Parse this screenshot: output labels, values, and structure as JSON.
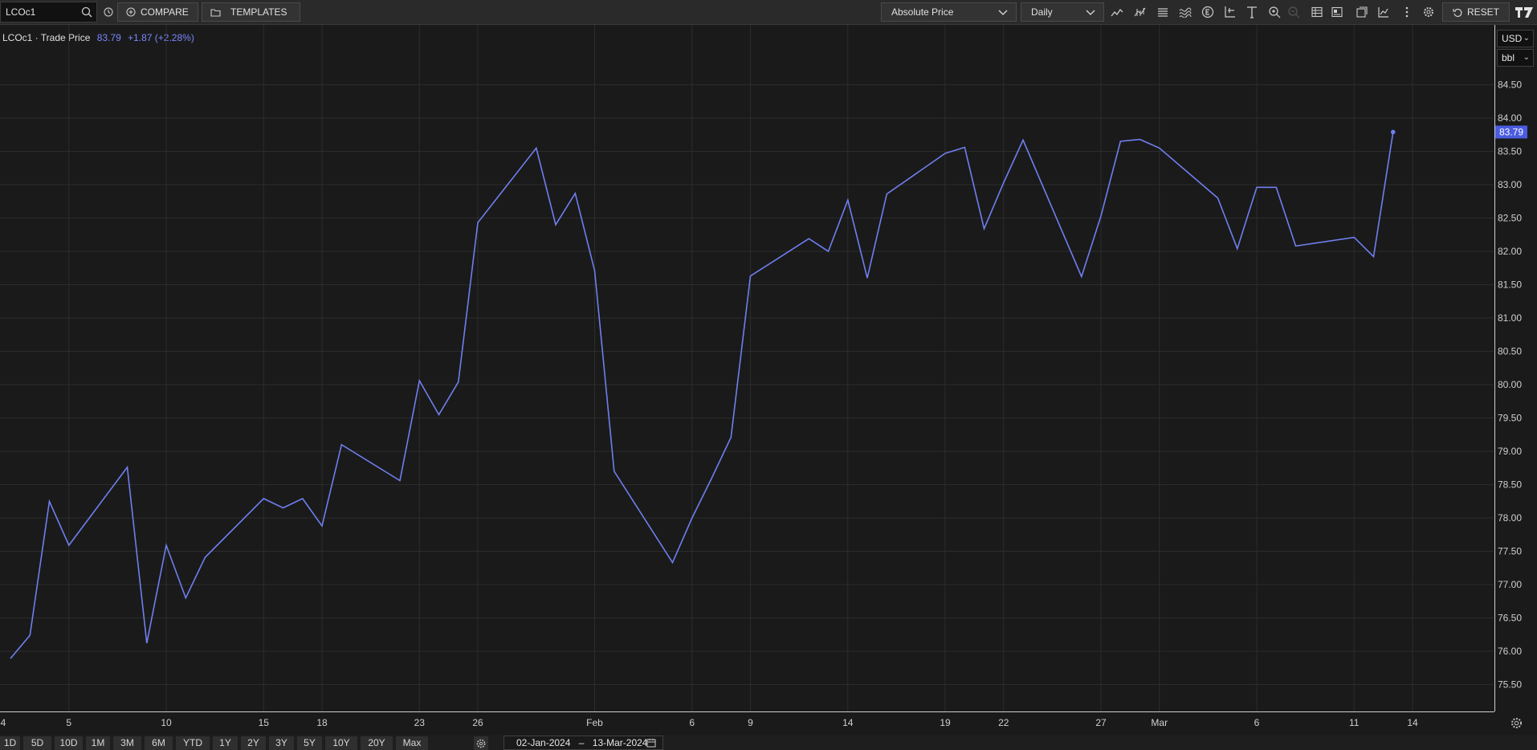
{
  "toolbar": {
    "ric_value": "LCOc1",
    "compare_label": "COMPARE",
    "templates_label": "TEMPLATES",
    "price_mode": "Absolute Price",
    "interval": "Daily",
    "reset_label": "RESET"
  },
  "header": {
    "title": "LCOc1 · Trade Price",
    "last": "83.79",
    "change": "+1.87 (+2.28%)"
  },
  "units": {
    "currency": "USD",
    "unit": "bbl"
  },
  "last_marker": "83.79",
  "colors": {
    "line": "#6f7ff0",
    "background": "#1a1a1a",
    "grid": "#2c2c2c",
    "marker": "#4b5ce0"
  },
  "ranges": [
    "1D",
    "5D",
    "10D",
    "1M",
    "3M",
    "6M",
    "YTD",
    "1Y",
    "2Y",
    "3Y",
    "5Y",
    "10Y",
    "20Y",
    "Max"
  ],
  "date_range": {
    "from": "02-Jan-2024",
    "to": "13-Mar-2024",
    "separator": "–"
  },
  "chart_data": {
    "type": "line",
    "x_labels": [
      "4",
      "5",
      "10",
      "15",
      "18",
      "23",
      "26",
      "Feb",
      "6",
      "9",
      "14",
      "19",
      "22",
      "27",
      "Mar",
      "6",
      "11",
      "14"
    ],
    "y_ticks": [
      "75.50",
      "76.00",
      "76.50",
      "77.00",
      "77.50",
      "78.00",
      "78.50",
      "79.00",
      "79.50",
      "80.00",
      "80.50",
      "81.00",
      "81.50",
      "82.00",
      "82.50",
      "83.00",
      "83.50",
      "84.00",
      "84.50"
    ],
    "ylim": [
      75.1,
      84.9
    ],
    "grid": true,
    "series": [
      {
        "x": [
          "2024-01-02",
          "2024-01-03",
          "2024-01-04",
          "2024-01-05",
          "2024-01-08",
          "2024-01-09",
          "2024-01-10",
          "2024-01-11",
          "2024-01-12",
          "2024-01-15",
          "2024-01-16",
          "2024-01-17",
          "2024-01-18",
          "2024-01-19",
          "2024-01-22",
          "2024-01-23",
          "2024-01-24",
          "2024-01-25",
          "2024-01-26",
          "2024-01-29",
          "2024-01-30",
          "2024-01-31",
          "2024-02-01",
          "2024-02-02",
          "2024-02-05",
          "2024-02-06",
          "2024-02-07",
          "2024-02-08",
          "2024-02-09",
          "2024-02-12",
          "2024-02-13",
          "2024-02-14",
          "2024-02-15",
          "2024-02-16",
          "2024-02-19",
          "2024-02-20",
          "2024-02-21",
          "2024-02-22",
          "2024-02-23",
          "2024-02-26",
          "2024-02-27",
          "2024-02-28",
          "2024-02-29",
          "2024-03-01",
          "2024-03-04",
          "2024-03-05",
          "2024-03-06",
          "2024-03-07",
          "2024-03-08",
          "2024-03-11",
          "2024-03-12",
          "2024-03-13"
        ],
        "values": [
          75.89,
          76.24,
          78.25,
          77.59,
          78.76,
          76.12,
          77.59,
          76.8,
          77.41,
          78.29,
          78.15,
          78.29,
          77.88,
          79.1,
          78.56,
          80.06,
          79.55,
          80.04,
          82.43,
          83.55,
          82.4,
          82.87,
          81.71,
          78.7,
          77.33,
          78.0,
          78.59,
          79.21,
          81.63,
          82.19,
          82.0,
          82.77,
          81.6,
          82.86,
          83.47,
          83.56,
          82.34,
          83.03,
          83.67,
          81.62,
          82.53,
          83.65,
          83.68,
          83.55,
          82.8,
          82.04,
          82.96,
          82.96,
          82.08,
          82.21,
          81.92,
          83.79
        ]
      }
    ]
  }
}
